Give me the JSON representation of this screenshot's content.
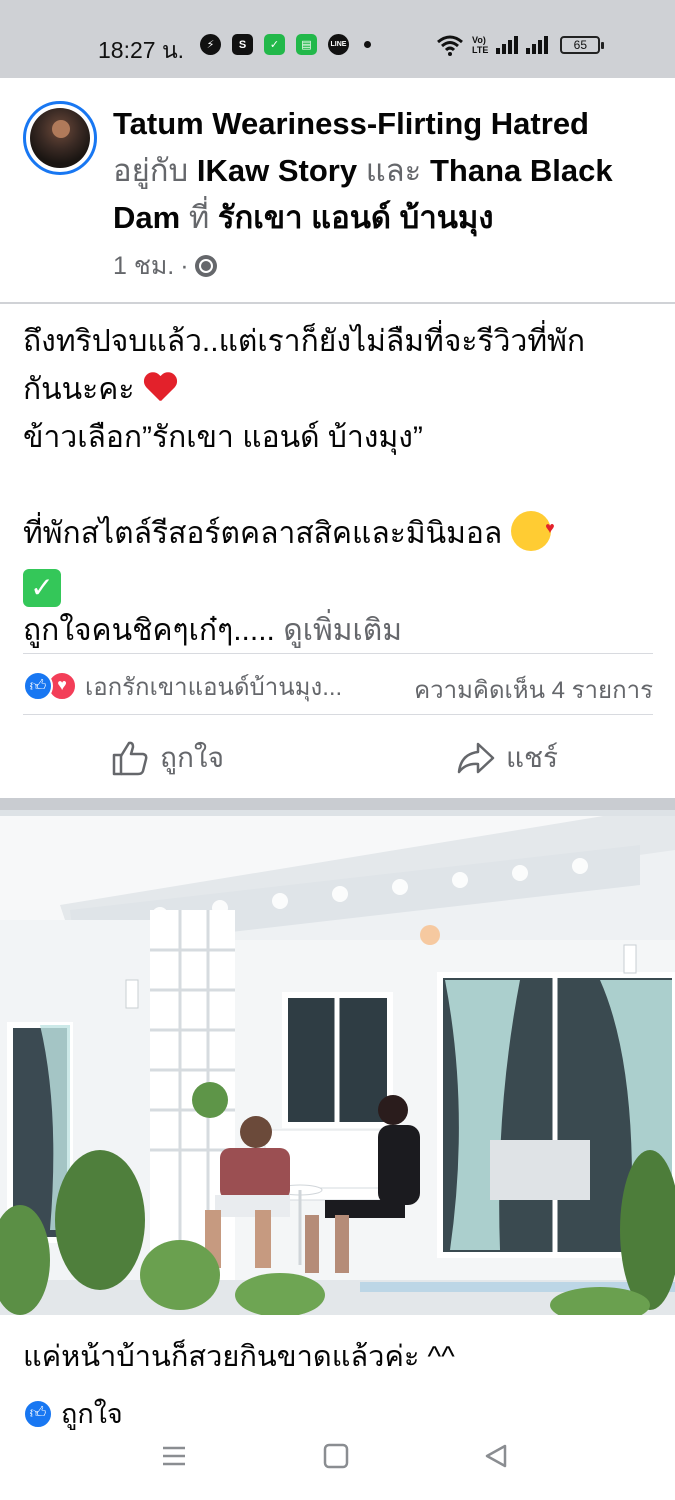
{
  "status_bar": {
    "time": "18:27 น.",
    "volte_line1": "Vo)",
    "volte_line2": "LTE",
    "battery": "65"
  },
  "post": {
    "author": "Tatum Weariness-Flirting Hatred",
    "with_prefix": "อยู่กับ",
    "tagged1": "IKaw Story",
    "and_word": "และ",
    "tagged2": "Thana Black Dam",
    "at_word": "ที่",
    "place": "รักเขา แอนด์ บ้านมุง",
    "time_ago": "1 ชม.",
    "separator": "·",
    "text_line1": "ถึงทริปจบแล้ว..แต่เราก็ยังไม่ลืมที่จะรีวิวที่พัก",
    "text_line2": "กันนะคะ",
    "text_line3": "ข้าวเลือก”รักเขา แอนด์ บ้างมุง”",
    "text_line4": "ที่พักสไตล์รีสอร์ตคลาสสิคและมินิมอล",
    "text_line6": "ถูกใจคนชิคๆเก๋ๆ.....",
    "see_more": "ดูเพิ่มเติม"
  },
  "reactions": {
    "names": "เอกรักเขาแอนด์บ้านมุง...",
    "comments": "ความคิดเห็น 4 รายการ"
  },
  "actions": {
    "like": "ถูกใจ",
    "share": "แชร์"
  },
  "photo": {
    "caption": "แค่หน้าบ้านก็สวยกินขาดแล้วค่ะ ^^",
    "reaction_label": "ถูกใจ"
  },
  "icons": {
    "accent": "#1877f2",
    "love": "#f33e58"
  }
}
